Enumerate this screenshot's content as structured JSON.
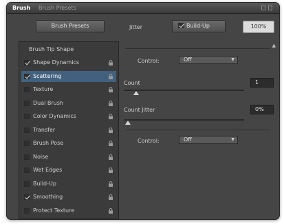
{
  "tabs": {
    "active": "Brush",
    "inactive": "Brush Presets"
  },
  "toolbar": {
    "presets_button": "Brush Presets",
    "label": "Jitter",
    "buildup_label": "Build-Up",
    "percent_value": "100%"
  },
  "sidebar": {
    "section_title": "Brush Tip Shape",
    "items": [
      {
        "label": "Shape Dynamics",
        "checked": true,
        "selected": false
      },
      {
        "label": "Scattering",
        "checked": true,
        "selected": true
      },
      {
        "label": "Texture",
        "checked": false,
        "selected": false
      },
      {
        "label": "Dual Brush",
        "checked": false,
        "selected": false
      },
      {
        "label": "Color Dynamics",
        "checked": false,
        "selected": false
      },
      {
        "label": "Transfer",
        "checked": false,
        "selected": false
      },
      {
        "label": "Brush Pose",
        "checked": false,
        "selected": false
      },
      {
        "label": "Noise",
        "checked": false,
        "selected": false
      },
      {
        "label": "Wet Edges",
        "checked": false,
        "selected": false
      },
      {
        "label": "Build-Up",
        "checked": false,
        "selected": false
      },
      {
        "label": "Smoothing",
        "checked": true,
        "selected": false
      },
      {
        "label": "Protect Texture",
        "checked": false,
        "selected": false
      }
    ]
  },
  "main": {
    "control1": {
      "label": "Control:",
      "value": "Off"
    },
    "count": {
      "label": "Count",
      "value": "1"
    },
    "count_jitter": {
      "label": "Count Jitter",
      "value": "0%"
    },
    "control2": {
      "label": "Control:",
      "value": "Off"
    }
  },
  "colors": {
    "selected_row": "#41617f",
    "panel_bg": "#454545"
  }
}
